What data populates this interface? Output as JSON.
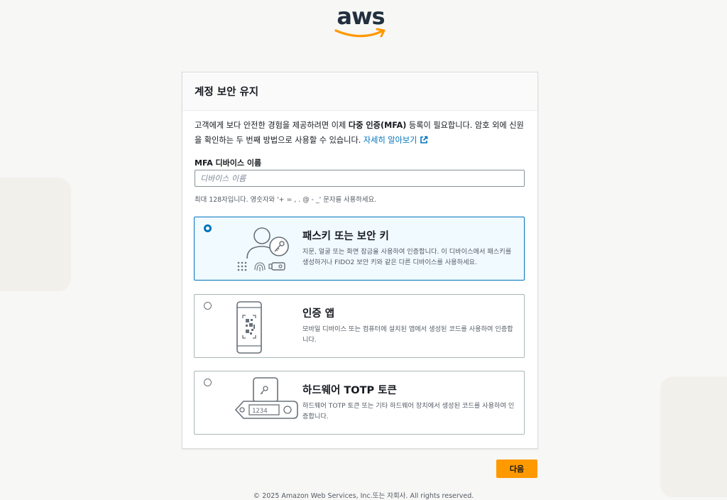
{
  "brand": {
    "logo_text": "aws",
    "accent_color": "#ff9900"
  },
  "card": {
    "title": "계정 보안 유지",
    "intro": {
      "part1": "고객에게 보다 안전한 경험을 제공하려면 이제 ",
      "bold": "다중 인증(MFA)",
      "part2": " 등록이 필요합니다. 암호 외에 신원을 확인하는 두 번째 방법으로 사용할 수 있습니다. ",
      "learn_more": "자세히 알아보기"
    },
    "device_name": {
      "label": "MFA 디바이스 이름",
      "value": "",
      "placeholder": "디바이스 이름",
      "hint": "최대 128자입니다. 영숫자와 '+ = , . @ - _' 문자를 사용하세요."
    },
    "options": [
      {
        "title": "패스키 또는 보안 키",
        "description": "지문, 얼굴 또는 화면 잠금을 사용하여 인증합니다. 이 디바이스에서 패스키를 생성하거나 FIDO2 보안 키와 같은 다른 디바이스를 사용하세요.",
        "selected": true,
        "icon": "passkey-illustration"
      },
      {
        "title": "인증 앱",
        "description": "모바일 디바이스 또는 컴퓨터에 설치된 앱에서 생성된 코드를 사용하여 인증합니다.",
        "selected": false,
        "icon": "authenticator-app-illustration"
      },
      {
        "title": "하드웨어 TOTP 토큰",
        "description": "하드웨어 TOTP 토큰 또는 기타 하드웨어 장치에서 생성된 코드를 사용하여 인증합니다.",
        "selected": false,
        "icon": "hardware-token-illustration",
        "token_display": "1234"
      }
    ]
  },
  "next_button": "다음",
  "footer": "© 2025 Amazon Web Services, Inc.또는 자회사. All rights reserved."
}
